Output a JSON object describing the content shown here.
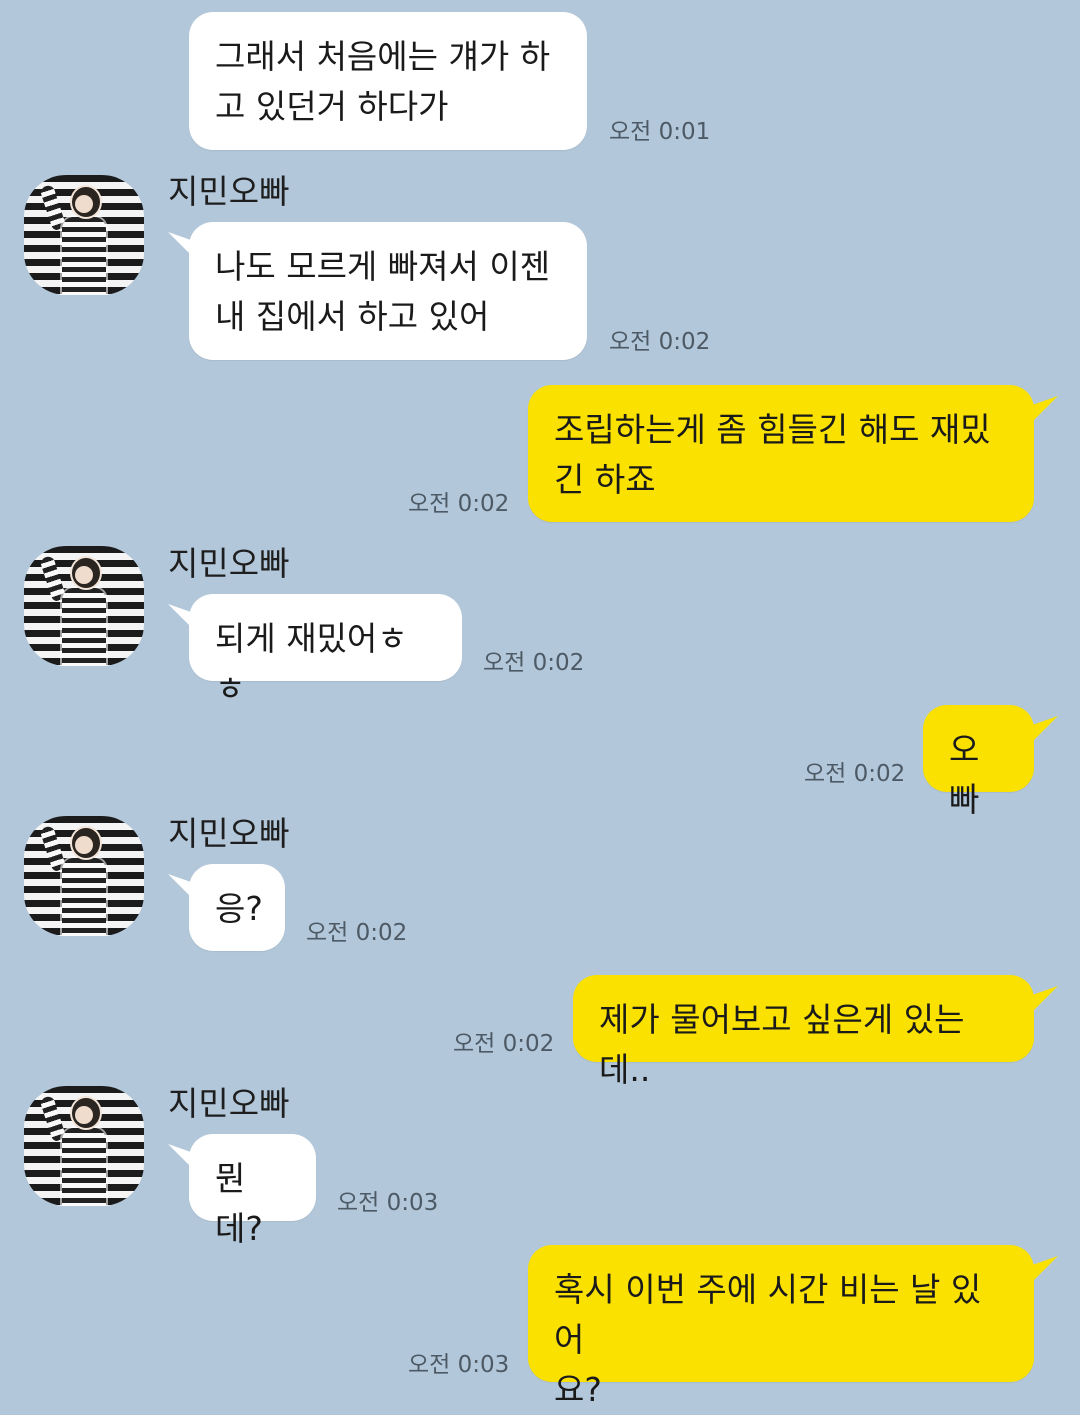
{
  "contact_name": "지민오빠",
  "messages": [
    {
      "sender": "contact",
      "text": "그래서 처음에는 걔가 하\n고 있던거 하다가",
      "time": "오전 0:01"
    },
    {
      "sender": "contact",
      "text": "나도 모르게 빠져서 이젠\n내 집에서 하고 있어",
      "time": "오전 0:02"
    },
    {
      "sender": "me",
      "text": "조립하는게 좀 힘들긴 해도 재밌\n긴 하죠",
      "time": "오전 0:02"
    },
    {
      "sender": "contact",
      "text": "되게 재밌어ㅎㅎ",
      "time": "오전 0:02"
    },
    {
      "sender": "me",
      "text": "오빠",
      "time": "오전 0:02"
    },
    {
      "sender": "contact",
      "text": "응?",
      "time": "오전 0:02"
    },
    {
      "sender": "me",
      "text": "제가 물어보고 싶은게 있는데..",
      "time": "오전 0:02"
    },
    {
      "sender": "contact",
      "text": "뭔데?",
      "time": "오전 0:03"
    },
    {
      "sender": "me",
      "text": "혹시 이번 주에 시간 비는 날 있어\n요?",
      "time": "오전 0:03"
    }
  ],
  "colors": {
    "background": "#b2c7d9",
    "incoming_bubble": "#ffffff",
    "outgoing_bubble": "#fae100"
  },
  "icons": {
    "avatar": "profile-photo-striped-shirt"
  }
}
